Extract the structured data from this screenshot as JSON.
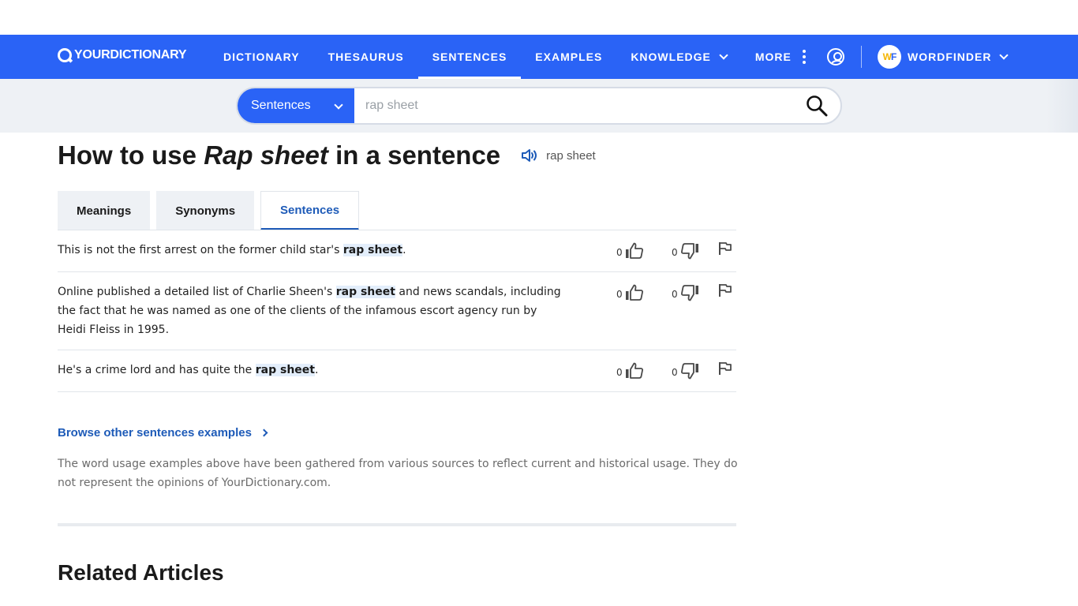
{
  "nav": {
    "logo": "YOURDICTIONARY",
    "items": [
      {
        "label": "DICTIONARY",
        "active": false
      },
      {
        "label": "THESAURUS",
        "active": false
      },
      {
        "label": "SENTENCES",
        "active": true
      },
      {
        "label": "EXAMPLES",
        "active": false
      },
      {
        "label": "KNOWLEDGE",
        "active": false
      },
      {
        "label": "MORE",
        "active": false
      }
    ],
    "wordfinder": "WORDFINDER",
    "brand_color": "#2a63f6"
  },
  "search": {
    "category": "Sentences",
    "placeholder": "rap sheet"
  },
  "page": {
    "title_prefix": "How to use ",
    "title_term": "Rap sheet",
    "title_suffix": " in a sentence",
    "pronunciation": "rap sheet"
  },
  "tabs": [
    {
      "label": "Meanings",
      "active": false
    },
    {
      "label": "Synonyms",
      "active": false
    },
    {
      "label": "Sentences",
      "active": true
    }
  ],
  "sentences": [
    {
      "before": "This is not the first arrest on the former child star's ",
      "term": "rap sheet",
      "after": ".",
      "up": "0",
      "down": "0"
    },
    {
      "before": "Online published a detailed list of Charlie Sheen's ",
      "term": "rap sheet",
      "after": " and news scandals, including the fact that he was named as one of the clients of the infamous escort agency run by Heidi Fleiss in 1995.",
      "up": "0",
      "down": "0"
    },
    {
      "before": "He's a crime lord and has quite the ",
      "term": "rap sheet",
      "after": ".",
      "up": "0",
      "down": "0"
    }
  ],
  "browse": "Browse other sentences examples",
  "disclaimer": "The word usage examples above have been gathered from various sources to reflect current and historical usage. They do not represent the opinions of YourDictionary.com.",
  "related_heading": "Related Articles",
  "colors": {
    "link": "#1e5bb8",
    "highlight": "#e3eefb",
    "search_band": "#eef1f5"
  }
}
